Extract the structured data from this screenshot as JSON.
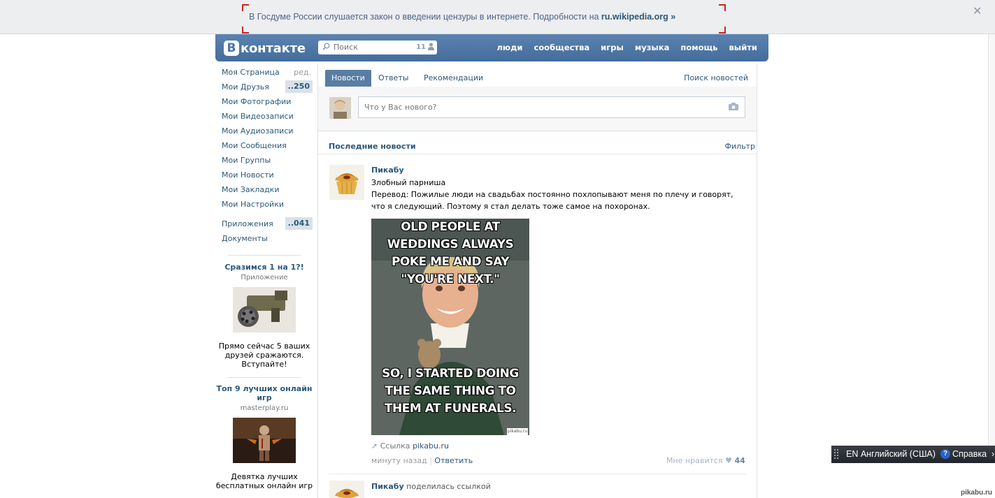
{
  "banner": {
    "text": "В Госдуме России слушается закон о введении цензуры в интернете. Подробности на",
    "link": "ru.wikipedia.org »",
    "close": "✕"
  },
  "header": {
    "logo_letter": "В",
    "logo_text": "контакте",
    "search_placeholder": "Поиск",
    "search_count": "11",
    "nav": [
      "люди",
      "сообщества",
      "игры",
      "музыка",
      "помощь",
      "выйти"
    ]
  },
  "leftmenu": {
    "items": [
      {
        "label": "Моя Страница",
        "extra": "ред."
      },
      {
        "label": "Мои Друзья",
        "badge": "..250"
      },
      {
        "label": "Мои Фотографии"
      },
      {
        "label": "Мои Видеозаписи"
      },
      {
        "label": "Мои Аудиозаписи"
      },
      {
        "label": "Мои Сообщения"
      },
      {
        "label": "Мои Группы"
      },
      {
        "label": "Мои Новости"
      },
      {
        "label": "Мои Закладки"
      },
      {
        "label": "Мои Настройки"
      }
    ],
    "apps": [
      {
        "label": "Приложения",
        "badge": "..041"
      },
      {
        "label": "Документы"
      }
    ],
    "promo1": {
      "title": "Сразимся 1 на 1?!",
      "sub": "Приложение",
      "text": "Прямо сейчас 5 ваших друзей сражаются. Вступайте!"
    },
    "promo2": {
      "title": "Топ 9 лучших онлайн игр",
      "sub": "masterplay.ru",
      "text": "Девятка лучших бесплатных онлайн игр"
    }
  },
  "main": {
    "tabs": [
      "Новости",
      "Ответы",
      "Рекомендации"
    ],
    "tab_search": "Поиск новостей",
    "post_placeholder": "Что у Вас нового?",
    "feed_title": "Последние новости",
    "filter": "Фильтр"
  },
  "post1": {
    "author": "Пикабу",
    "title": "Злобный парниша",
    "text": "Перевод: Пожилые люди на свадьбах постоянно похлопывают меня по плечу и говорят, что я следующий. Поэтому я стал делать тоже самое на похоронах.",
    "meme_top": "OLD PEOPLE AT WEDDINGS ALWAYS POKE ME AND SAY \"YOU'RE NEXT.\"",
    "meme_bottom": "SO, I STARTED DOING THE SAME THING TO THEM AT FUNERALS.",
    "meme_watermark": "pikabu.ru",
    "link_label": "Ссылка",
    "link_domain": "pikabu.ru",
    "time": "минуту назад",
    "reply": "Ответить",
    "like_label": "Мне нравится",
    "like_count": "44"
  },
  "post2": {
    "author": "Пикабу",
    "action": "поделилась ссылкой"
  },
  "langbar": {
    "lang": "EN Английский (США)",
    "help_icon": "?",
    "help": "Справка"
  },
  "watermark": "pikabu.ru"
}
